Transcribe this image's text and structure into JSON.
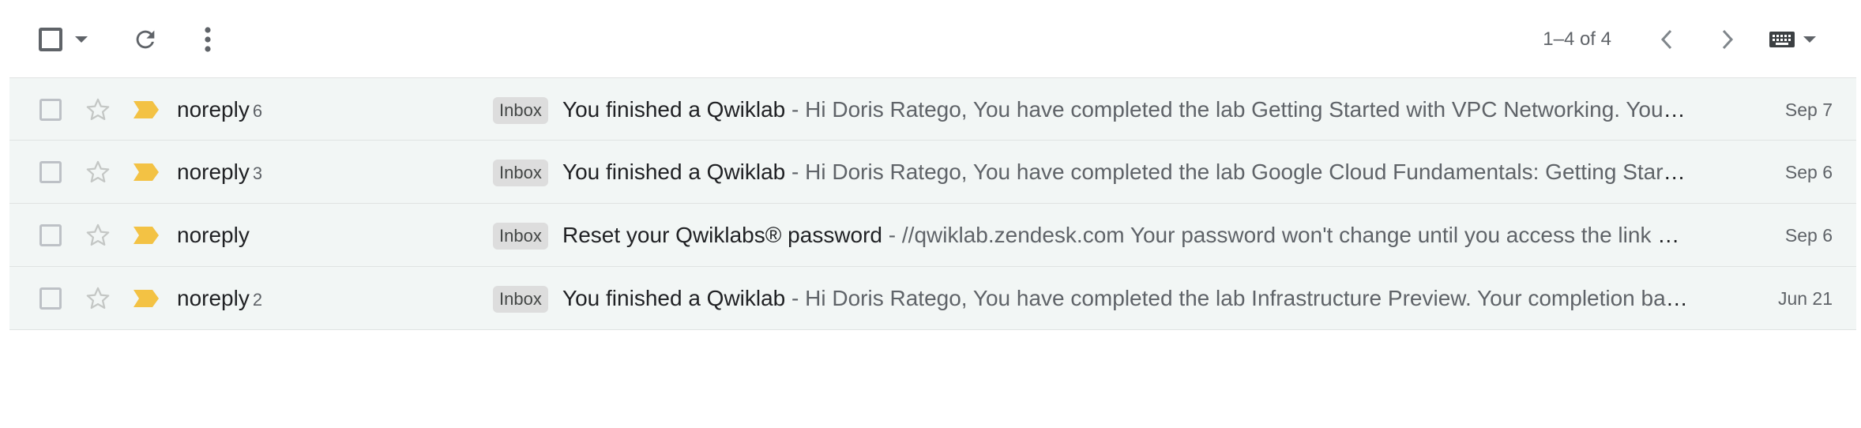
{
  "toolbar": {
    "pager_text": "1–4 of 4"
  },
  "colors": {
    "row_bg": "#f2f6f5",
    "importance_marker": "#f3c244",
    "label_bg": "#dddddd",
    "icon_gray": "#5f6368"
  },
  "icons": {
    "select_all": "checkbox-icon",
    "select_menu": "caret-down-icon",
    "refresh": "refresh-icon",
    "more": "more-vert-icon",
    "prev": "chevron-left-icon",
    "next": "chevron-right-icon",
    "input_tools": "keyboard-icon",
    "row_star": "star-outline-icon",
    "row_importance": "importance-marker-icon"
  },
  "rows": [
    {
      "sender": "noreply",
      "count": "6",
      "label": "Inbox",
      "subject": "You finished a Qwiklab",
      "separator": " - ",
      "snippet": "Hi Doris Ratego, You have completed the lab Getting Started with VPC Networking. Your completion badge has been added",
      "date": "Sep 7"
    },
    {
      "sender": "noreply",
      "count": "3",
      "label": "Inbox",
      "subject": "You finished a Qwiklab",
      "separator": " - ",
      "snippet": "Hi Doris Ratego, You have completed the lab Google Cloud Fundamentals: Getting Started with App Engine",
      "date": "Sep 6"
    },
    {
      "sender": "noreply",
      "count": "",
      "label": "Inbox",
      "subject": "Reset your Qwiklabs® password",
      "separator": " - ",
      "snippet": "//qwiklab.zendesk.com Your password won't change until you access the link above",
      "date": "Sep 6"
    },
    {
      "sender": "noreply",
      "count": "2",
      "label": "Inbox",
      "subject": "You finished a Qwiklab",
      "separator": " - ",
      "snippet": "Hi Doris Ratego, You have completed the lab Infrastructure Preview. Your completion badge has been added",
      "date": "Jun 21"
    }
  ]
}
